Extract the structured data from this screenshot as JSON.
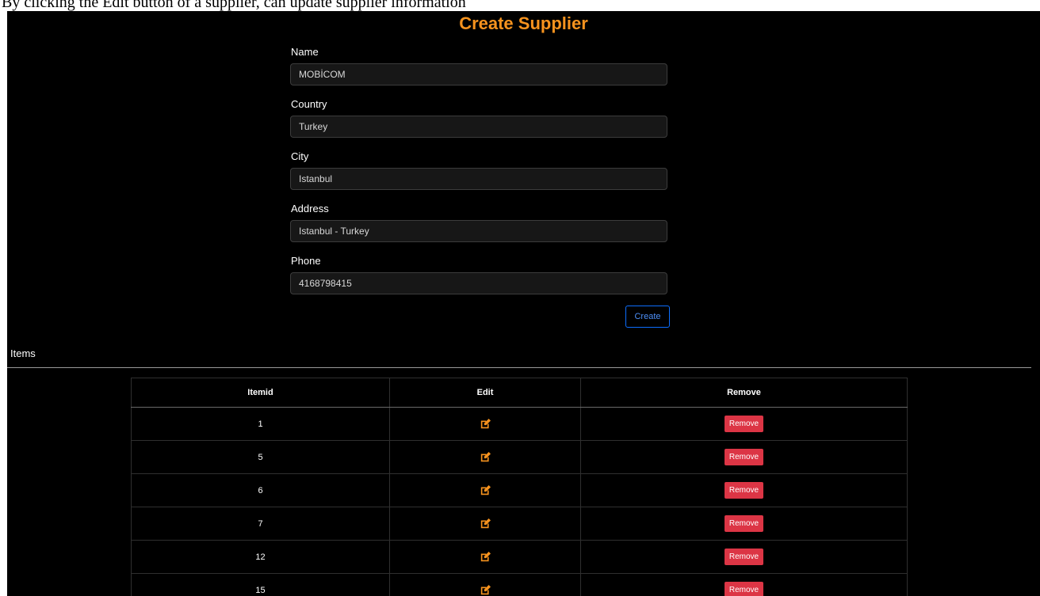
{
  "caption_strip": "By clicking the Edit button of a supplier, can update supplier information",
  "page": {
    "title": "Create Supplier"
  },
  "form": {
    "fields": [
      {
        "label": "Name",
        "value": "MOBİCOM"
      },
      {
        "label": "Country",
        "value": "Turkey"
      },
      {
        "label": "City",
        "value": "Istanbul"
      },
      {
        "label": "Address",
        "value": "Istanbul - Turkey"
      },
      {
        "label": "Phone",
        "value": "4168798415"
      }
    ],
    "submit_label": "Create"
  },
  "items_section": {
    "title": "Items",
    "columns": [
      "Itemid",
      "Edit",
      "Remove"
    ],
    "rows": [
      {
        "itemid": "1",
        "edit_icon": "edit-icon",
        "remove_label": "Remove"
      },
      {
        "itemid": "5",
        "edit_icon": "edit-icon",
        "remove_label": "Remove"
      },
      {
        "itemid": "6",
        "edit_icon": "edit-icon",
        "remove_label": "Remove"
      },
      {
        "itemid": "7",
        "edit_icon": "edit-icon",
        "remove_label": "Remove"
      },
      {
        "itemid": "12",
        "edit_icon": "edit-icon",
        "remove_label": "Remove"
      },
      {
        "itemid": "15",
        "edit_icon": "edit-icon",
        "remove_label": "Remove"
      }
    ]
  },
  "colors": {
    "background": "#000000",
    "title_accent": "#f7931e",
    "edit_icon": "#f7931e",
    "primary_outline": "#0d6efd",
    "danger": "#dc3545",
    "input_background": "#171717"
  }
}
